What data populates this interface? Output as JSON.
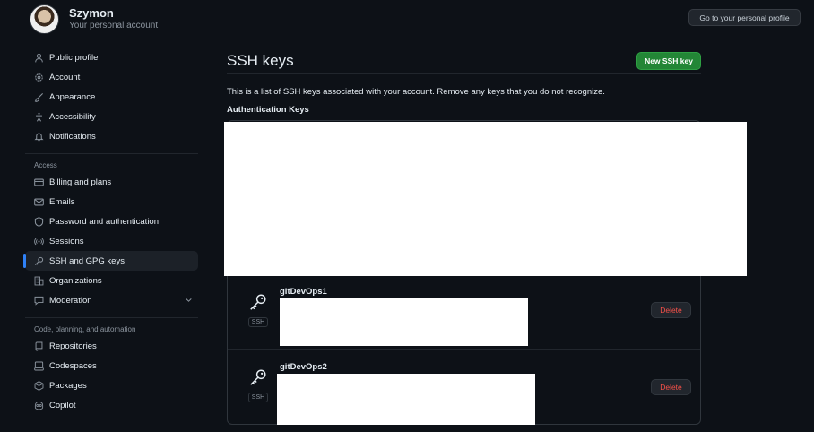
{
  "user": {
    "name": "Szymon",
    "subtitle": "Your personal account"
  },
  "header": {
    "profile_button": "Go to your personal profile"
  },
  "sidebar": {
    "items": [
      {
        "label": "Public profile",
        "icon": "person-icon"
      },
      {
        "label": "Account",
        "icon": "gear-icon"
      },
      {
        "label": "Appearance",
        "icon": "paintbrush-icon"
      },
      {
        "label": "Accessibility",
        "icon": "accessibility-icon"
      },
      {
        "label": "Notifications",
        "icon": "bell-icon"
      }
    ],
    "access_label": "Access",
    "access_items": [
      {
        "label": "Billing and plans",
        "icon": "credit-card-icon"
      },
      {
        "label": "Emails",
        "icon": "mail-icon"
      },
      {
        "label": "Password and authentication",
        "icon": "shield-icon"
      },
      {
        "label": "Sessions",
        "icon": "broadcast-icon"
      },
      {
        "label": "SSH and GPG keys",
        "icon": "key-icon",
        "active": true
      },
      {
        "label": "Organizations",
        "icon": "organization-icon"
      },
      {
        "label": "Moderation",
        "icon": "report-icon"
      }
    ],
    "code_label": "Code, planning, and automation",
    "code_items": [
      {
        "label": "Repositories",
        "icon": "repo-icon"
      },
      {
        "label": "Codespaces",
        "icon": "codespaces-icon"
      },
      {
        "label": "Packages",
        "icon": "package-icon"
      },
      {
        "label": "Copilot",
        "icon": "copilot-icon"
      }
    ]
  },
  "main": {
    "title": "SSH keys",
    "new_button": "New SSH key",
    "description": "This is a list of SSH keys associated with your account. Remove any keys that you do not recognize.",
    "auth_label": "Authentication Keys",
    "keys": [
      {
        "title": "gitDevOps1",
        "badge": "SSH",
        "delete_label": "Delete"
      },
      {
        "title": "gitDevOps2",
        "badge": "SSH",
        "delete_label": "Delete"
      }
    ]
  },
  "colors": {
    "background": "#0d1117",
    "accent": "#2f81f7",
    "primary_button": "#238636",
    "danger": "#f85149"
  }
}
